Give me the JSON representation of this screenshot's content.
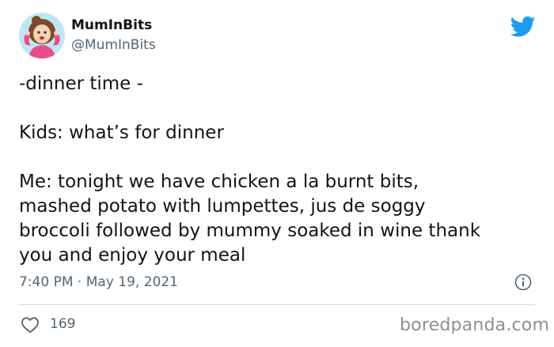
{
  "author": {
    "display_name": "MumInBits",
    "handle": "@MumInBits",
    "avatar_icon": "cartoon-mum-avatar"
  },
  "brand": {
    "icon": "twitter-bird-icon",
    "color": "#1d9bf0"
  },
  "tweet": {
    "lines": [
      "-dinner time -",
      "",
      "Kids: what’s for dinner",
      "",
      "Me: tonight we have chicken a la burnt bits,",
      "mashed potato with lumpettes, jus de soggy",
      "broccoli followed by mummy soaked in wine thank",
      "you and enjoy your meal"
    ],
    "timestamp": "7:40 PM · May 19, 2021"
  },
  "actions": {
    "like_icon": "heart-icon",
    "like_count": "169",
    "info_icon": "info-icon"
  },
  "watermark": "boredpanda.com",
  "colors": {
    "text": "#0f1419",
    "secondary": "#536471",
    "divider": "#cfd9de"
  }
}
